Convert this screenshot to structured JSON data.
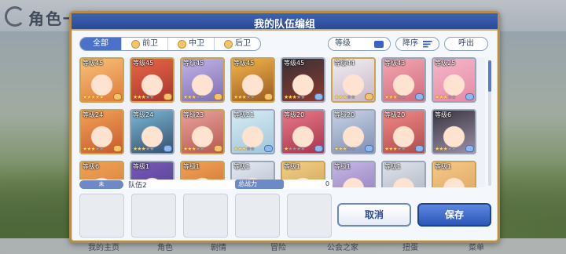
{
  "background": {
    "title": "角色一览",
    "bottom_tabs": [
      "我的主页",
      "角色",
      "剧情",
      "冒险",
      "公会之家",
      "扭蛋",
      "菜单"
    ]
  },
  "modal": {
    "title": "我的队伍编组",
    "filters": [
      {
        "label": "全部",
        "active": true
      },
      {
        "label": "前卫",
        "active": false
      },
      {
        "label": "中卫",
        "active": false
      },
      {
        "label": "后卫",
        "active": false
      }
    ],
    "sort_label": "等级",
    "order_label": "降序",
    "call_label": "呼出"
  },
  "roster": [
    {
      "level": "等级45",
      "stars": 5,
      "max_stars": 5,
      "pos": "gold",
      "colors": [
        "#f7c27a",
        "#e07a3a"
      ]
    },
    {
      "level": "等级45",
      "stars": 3,
      "max_stars": 5,
      "pos": "gold",
      "colors": [
        "#e9674a",
        "#a8342c"
      ]
    },
    {
      "level": "等级45",
      "stars": 3,
      "max_stars": 5,
      "pos": "gold",
      "colors": [
        "#c5b4e6",
        "#7c6fb5"
      ]
    },
    {
      "level": "等级45",
      "stars": 3,
      "max_stars": 5,
      "pos": "gold",
      "colors": [
        "#f3b64a",
        "#9a5a22"
      ]
    },
    {
      "level": "等级45",
      "stars": 3,
      "max_stars": 5,
      "pos": "blue",
      "colors": [
        "#3a3038",
        "#8a3a2c"
      ]
    },
    {
      "level": "等级44",
      "stars": 3,
      "max_stars": 5,
      "pos": "gold",
      "colors": [
        "#f1eef2",
        "#c8b6c6"
      ]
    },
    {
      "level": "等级43",
      "stars": 3,
      "max_stars": 5,
      "pos": "blue",
      "colors": [
        "#f3a7b2",
        "#d26b7c"
      ]
    },
    {
      "level": "等级25",
      "stars": 3,
      "max_stars": 5,
      "pos": "blue",
      "colors": [
        "#f5b7c9",
        "#e58aa5"
      ]
    },
    {
      "level": "等级24",
      "stars": 3,
      "max_stars": 5,
      "pos": "gold",
      "colors": [
        "#f2a257",
        "#c75a2e"
      ]
    },
    {
      "level": "等级24",
      "stars": 3,
      "max_stars": 5,
      "pos": "blue",
      "colors": [
        "#7bb8d6",
        "#34506e"
      ]
    },
    {
      "level": "等级23",
      "stars": 3,
      "max_stars": 5,
      "pos": "gold",
      "colors": [
        "#e9a3a0",
        "#b8584e"
      ]
    },
    {
      "level": "等级21",
      "stars": 3,
      "max_stars": 5,
      "pos": "blue",
      "colors": [
        "#d8ecf5",
        "#9fc6d8"
      ]
    },
    {
      "level": "等级20",
      "stars": 1,
      "max_stars": 5,
      "pos": "blue",
      "colors": [
        "#e87a8a",
        "#a8344c"
      ]
    },
    {
      "level": "等级20",
      "stars": 3,
      "max_stars": 5,
      "pos": "blue",
      "colors": [
        "#c9d3e6",
        "#7f8fb3"
      ]
    },
    {
      "level": "等级20",
      "stars": 3,
      "max_stars": 5,
      "pos": "blue",
      "colors": [
        "#f08a8a",
        "#b24a4a"
      ]
    },
    {
      "level": "等级6",
      "stars": 3,
      "max_stars": 5,
      "pos": "blue",
      "colors": [
        "#3a3540",
        "#9a90a8"
      ]
    },
    {
      "level": "等级6",
      "stars": 0,
      "max_stars": 5,
      "pos": "gold",
      "colors": [
        "#f2a257",
        "#d27a3a"
      ]
    },
    {
      "level": "等级1",
      "stars": 0,
      "max_stars": 5,
      "pos": "blue",
      "colors": [
        "#7a5ab8",
        "#4a3a8a"
      ]
    },
    {
      "level": "等级1",
      "stars": 0,
      "max_stars": 5,
      "pos": "gold",
      "colors": [
        "#f2a257",
        "#c86a2e"
      ]
    },
    {
      "level": "等级1",
      "stars": 0,
      "max_stars": 5,
      "pos": "blue",
      "colors": [
        "#e6eaf2",
        "#aab4c8"
      ]
    },
    {
      "level": "等级1",
      "stars": 0,
      "max_stars": 5,
      "pos": "gold",
      "colors": [
        "#f3d08a",
        "#c69a4a"
      ]
    },
    {
      "level": "等级1",
      "stars": 0,
      "max_stars": 5,
      "pos": "blue",
      "colors": [
        "#c9b8e6",
        "#8a78b8"
      ]
    },
    {
      "level": "等级1",
      "stars": 0,
      "max_stars": 5,
      "pos": "blue",
      "colors": [
        "#dfe3ea",
        "#a8b0c0"
      ]
    },
    {
      "level": "等级1",
      "stars": 0,
      "max_stars": 5,
      "pos": "gold",
      "colors": [
        "#f6c98a",
        "#dba15a"
      ]
    }
  ],
  "team": {
    "badge": "未",
    "name": "队伍2",
    "power_label": "总战力",
    "power_value": "0",
    "slots": 5
  },
  "buttons": {
    "cancel": "取消",
    "save": "保存"
  }
}
